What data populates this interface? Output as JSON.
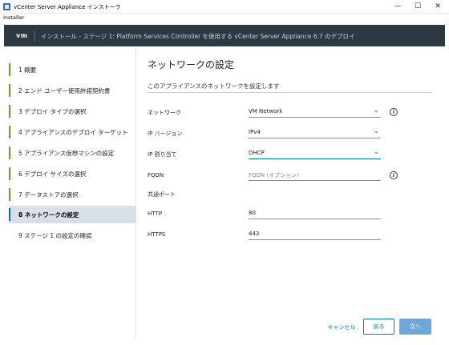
{
  "window": {
    "title": "vCenter Server Appliance インストーラ",
    "menu_installer": "Installer",
    "minimize_glyph": "—",
    "maximize_glyph": "☐",
    "close_glyph": "✕"
  },
  "header": {
    "logo": "vm",
    "title": "インストール - ステージ 1: Platform Services Controller を使用する vCenter Server Appliance 6.7 のデプロイ"
  },
  "sidebar": {
    "steps": [
      {
        "label": "1 概要"
      },
      {
        "label": "2 エンド ユーザー使用許諾契約書"
      },
      {
        "label": "3 デプロイ タイプの選択"
      },
      {
        "label": "4 アプライアンスのデプロイ ターゲット"
      },
      {
        "label": "5 アプライアンス仮想マシンの設定"
      },
      {
        "label": "6 デプロイ サイズの選択"
      },
      {
        "label": "7 データストアの選択"
      },
      {
        "label": "8 ネットワークの設定"
      },
      {
        "label": "9 ステージ 1 の設定の確認"
      }
    ],
    "active_index": 7,
    "completed_color": "#62a420",
    "active_color": "#0072a3"
  },
  "main": {
    "title": "ネットワークの設定",
    "subtitle": "このアプライアンスのネットワークを設定します",
    "form": {
      "network": {
        "label": "ネットワーク",
        "value": "VM Network"
      },
      "ip_version": {
        "label": "IP バージョン",
        "value": "IPv4"
      },
      "ip_assignment": {
        "label": "IP 割り当て",
        "value": "DHCP"
      },
      "fqdn": {
        "label": "FQDN",
        "placeholder": "FQDN (オプション)"
      },
      "common_ports": {
        "label": "共通ポート"
      },
      "http": {
        "label": "HTTP",
        "value": "80"
      },
      "https": {
        "label": "HTTPS",
        "value": "443"
      }
    },
    "info_glyph": "i",
    "chevron_glyph": "⌄"
  },
  "footer": {
    "cancel": "キャンセル",
    "back": "戻る",
    "next": "次へ"
  }
}
